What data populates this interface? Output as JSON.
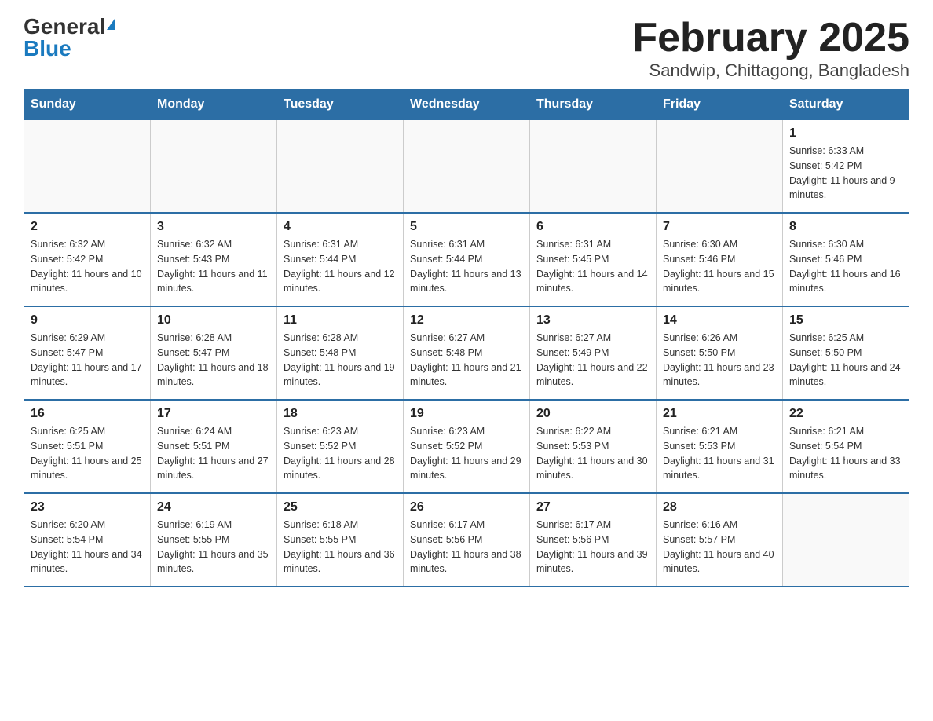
{
  "logo": {
    "general": "General",
    "blue": "Blue"
  },
  "title": "February 2025",
  "subtitle": "Sandwip, Chittagong, Bangladesh",
  "days_of_week": [
    "Sunday",
    "Monday",
    "Tuesday",
    "Wednesday",
    "Thursday",
    "Friday",
    "Saturday"
  ],
  "weeks": [
    [
      {
        "day": "",
        "info": ""
      },
      {
        "day": "",
        "info": ""
      },
      {
        "day": "",
        "info": ""
      },
      {
        "day": "",
        "info": ""
      },
      {
        "day": "",
        "info": ""
      },
      {
        "day": "",
        "info": ""
      },
      {
        "day": "1",
        "info": "Sunrise: 6:33 AM\nSunset: 5:42 PM\nDaylight: 11 hours and 9 minutes."
      }
    ],
    [
      {
        "day": "2",
        "info": "Sunrise: 6:32 AM\nSunset: 5:42 PM\nDaylight: 11 hours and 10 minutes."
      },
      {
        "day": "3",
        "info": "Sunrise: 6:32 AM\nSunset: 5:43 PM\nDaylight: 11 hours and 11 minutes."
      },
      {
        "day": "4",
        "info": "Sunrise: 6:31 AM\nSunset: 5:44 PM\nDaylight: 11 hours and 12 minutes."
      },
      {
        "day": "5",
        "info": "Sunrise: 6:31 AM\nSunset: 5:44 PM\nDaylight: 11 hours and 13 minutes."
      },
      {
        "day": "6",
        "info": "Sunrise: 6:31 AM\nSunset: 5:45 PM\nDaylight: 11 hours and 14 minutes."
      },
      {
        "day": "7",
        "info": "Sunrise: 6:30 AM\nSunset: 5:46 PM\nDaylight: 11 hours and 15 minutes."
      },
      {
        "day": "8",
        "info": "Sunrise: 6:30 AM\nSunset: 5:46 PM\nDaylight: 11 hours and 16 minutes."
      }
    ],
    [
      {
        "day": "9",
        "info": "Sunrise: 6:29 AM\nSunset: 5:47 PM\nDaylight: 11 hours and 17 minutes."
      },
      {
        "day": "10",
        "info": "Sunrise: 6:28 AM\nSunset: 5:47 PM\nDaylight: 11 hours and 18 minutes."
      },
      {
        "day": "11",
        "info": "Sunrise: 6:28 AM\nSunset: 5:48 PM\nDaylight: 11 hours and 19 minutes."
      },
      {
        "day": "12",
        "info": "Sunrise: 6:27 AM\nSunset: 5:48 PM\nDaylight: 11 hours and 21 minutes."
      },
      {
        "day": "13",
        "info": "Sunrise: 6:27 AM\nSunset: 5:49 PM\nDaylight: 11 hours and 22 minutes."
      },
      {
        "day": "14",
        "info": "Sunrise: 6:26 AM\nSunset: 5:50 PM\nDaylight: 11 hours and 23 minutes."
      },
      {
        "day": "15",
        "info": "Sunrise: 6:25 AM\nSunset: 5:50 PM\nDaylight: 11 hours and 24 minutes."
      }
    ],
    [
      {
        "day": "16",
        "info": "Sunrise: 6:25 AM\nSunset: 5:51 PM\nDaylight: 11 hours and 25 minutes."
      },
      {
        "day": "17",
        "info": "Sunrise: 6:24 AM\nSunset: 5:51 PM\nDaylight: 11 hours and 27 minutes."
      },
      {
        "day": "18",
        "info": "Sunrise: 6:23 AM\nSunset: 5:52 PM\nDaylight: 11 hours and 28 minutes."
      },
      {
        "day": "19",
        "info": "Sunrise: 6:23 AM\nSunset: 5:52 PM\nDaylight: 11 hours and 29 minutes."
      },
      {
        "day": "20",
        "info": "Sunrise: 6:22 AM\nSunset: 5:53 PM\nDaylight: 11 hours and 30 minutes."
      },
      {
        "day": "21",
        "info": "Sunrise: 6:21 AM\nSunset: 5:53 PM\nDaylight: 11 hours and 31 minutes."
      },
      {
        "day": "22",
        "info": "Sunrise: 6:21 AM\nSunset: 5:54 PM\nDaylight: 11 hours and 33 minutes."
      }
    ],
    [
      {
        "day": "23",
        "info": "Sunrise: 6:20 AM\nSunset: 5:54 PM\nDaylight: 11 hours and 34 minutes."
      },
      {
        "day": "24",
        "info": "Sunrise: 6:19 AM\nSunset: 5:55 PM\nDaylight: 11 hours and 35 minutes."
      },
      {
        "day": "25",
        "info": "Sunrise: 6:18 AM\nSunset: 5:55 PM\nDaylight: 11 hours and 36 minutes."
      },
      {
        "day": "26",
        "info": "Sunrise: 6:17 AM\nSunset: 5:56 PM\nDaylight: 11 hours and 38 minutes."
      },
      {
        "day": "27",
        "info": "Sunrise: 6:17 AM\nSunset: 5:56 PM\nDaylight: 11 hours and 39 minutes."
      },
      {
        "day": "28",
        "info": "Sunrise: 6:16 AM\nSunset: 5:57 PM\nDaylight: 11 hours and 40 minutes."
      },
      {
        "day": "",
        "info": ""
      }
    ]
  ]
}
